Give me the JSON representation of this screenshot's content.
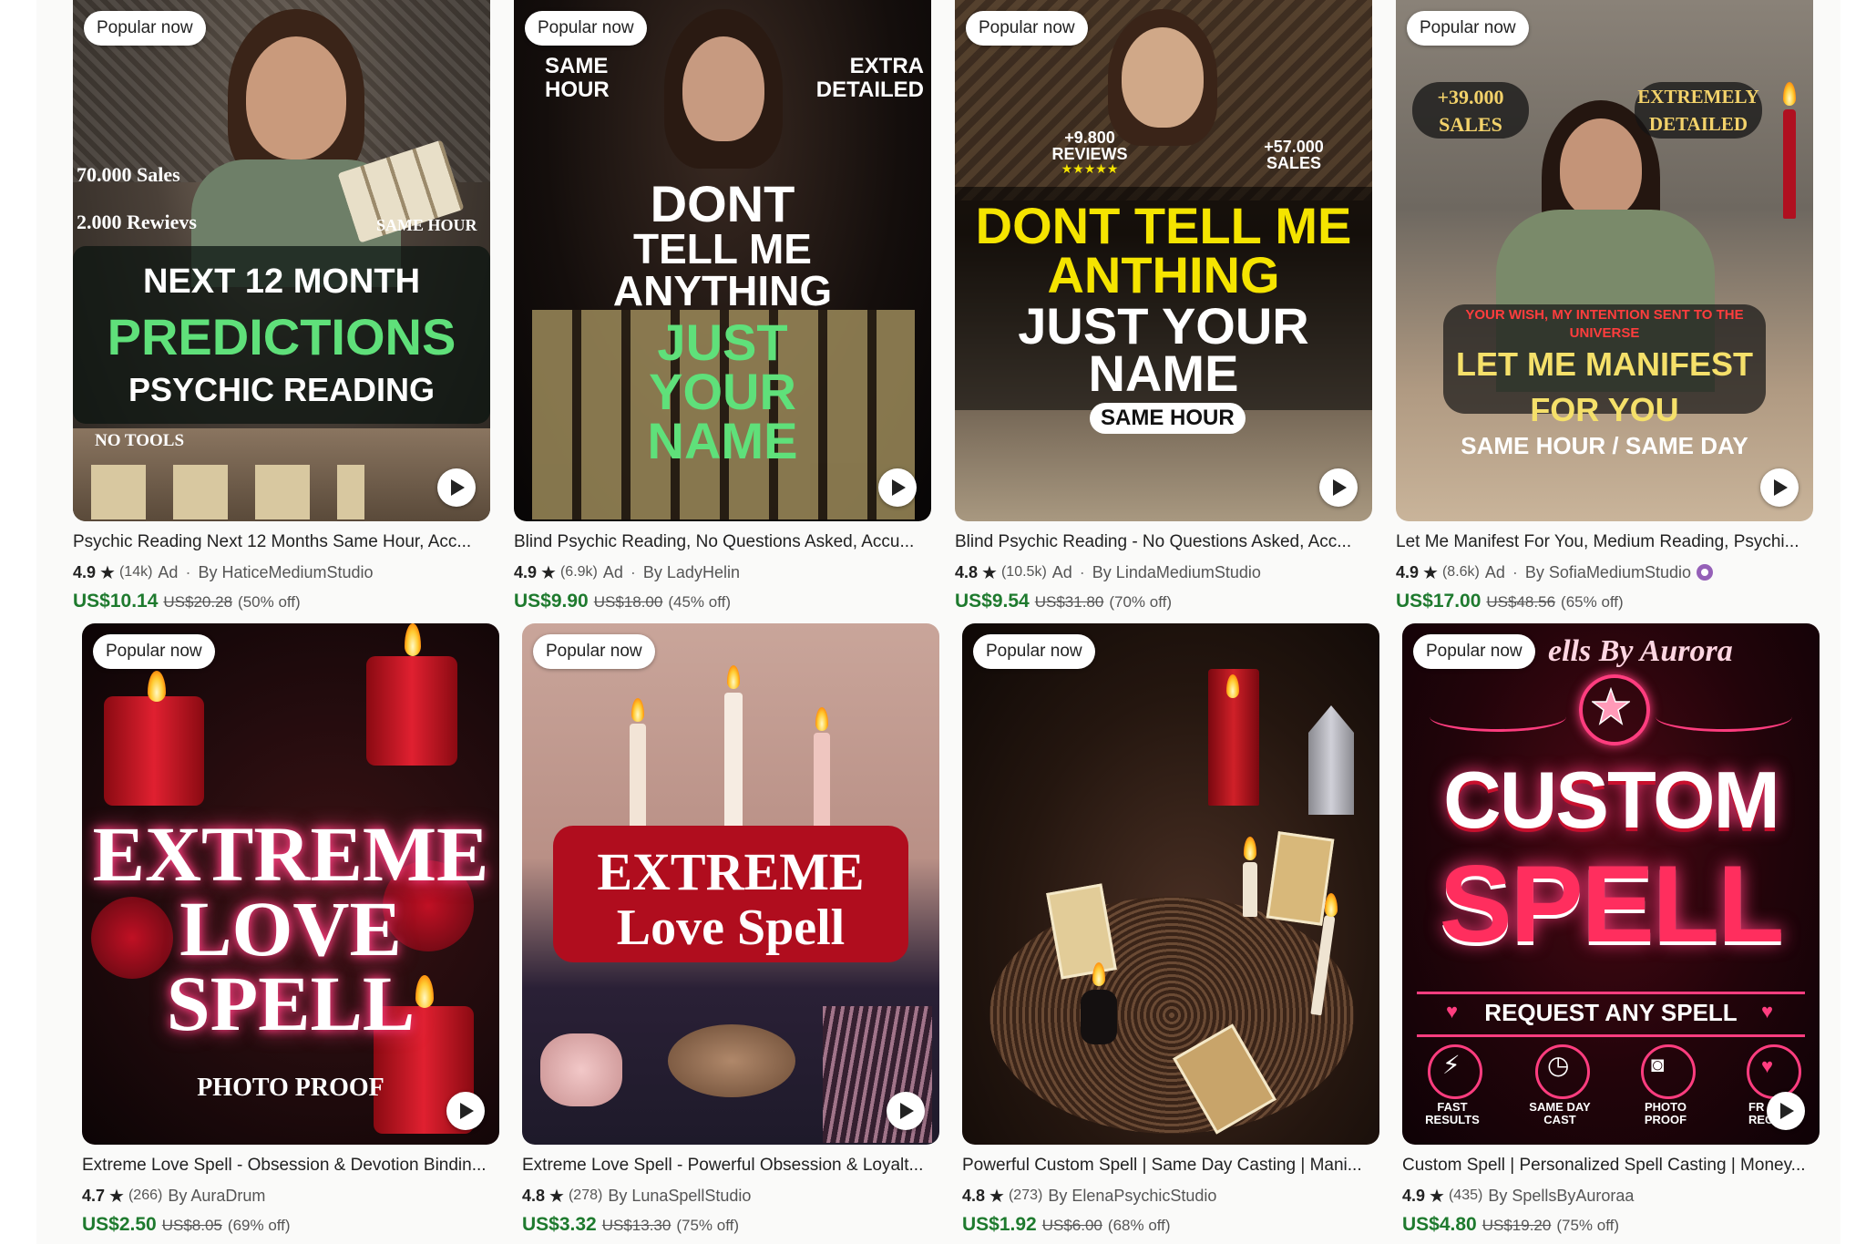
{
  "listings": [
    {
      "badge": "Popular now",
      "title": "Psychic Reading Next 12 Months Same Hour, Acc...",
      "rating": "4.9",
      "reviews": "(14k)",
      "ad": "Ad",
      "by": "By HaticeMediumStudio",
      "price": "US$10.14",
      "original_price": "US$20.28",
      "discount": "(50% off)",
      "thumb": {
        "line1": "70.000 Sales",
        "line2": "2.000 Rewievs",
        "line3": "SAME HOUR",
        "line4": "NEXT 12 MONTH",
        "line5": "PREDICTIONS",
        "line6": "PSYCHIC READING",
        "line7": "NO TOOLS"
      }
    },
    {
      "badge": "Popular now",
      "title": "Blind Psychic Reading, No Questions Asked, Accu...",
      "rating": "4.9",
      "reviews": "(6.9k)",
      "ad": "Ad",
      "by": "By LadyHelin",
      "price": "US$9.90",
      "original_price": "US$18.00",
      "discount": "(45% off)",
      "thumb": {
        "line1": "SAME HOUR",
        "line2": "EXTRA DETAILED",
        "line3": "DONT",
        "line4": "TELL ME",
        "line5": "ANYTHING",
        "line6": "JUST",
        "line7": "YOUR",
        "line8": "NAME"
      }
    },
    {
      "badge": "Popular now",
      "title": "Blind Psychic Reading - No Questions Asked, Acc...",
      "rating": "4.8",
      "reviews": "(10.5k)",
      "ad": "Ad",
      "by": "By LindaMediumStudio",
      "price": "US$9.54",
      "original_price": "US$31.80",
      "discount": "(70% off)",
      "thumb": {
        "line1": "+9.800",
        "line2": "REVIEWS",
        "line3": "+57.000",
        "line4": "SALES",
        "line5": "DONT TELL ME",
        "line6": "ANTHING",
        "line7": "JUST YOUR",
        "line8": "NAME",
        "line9": "SAME HOUR",
        "stars": "★★★★★"
      }
    },
    {
      "badge": "Popular now",
      "title": "Let Me Manifest For You, Medium Reading, Psychi...",
      "rating": "4.9",
      "reviews": "(8.6k)",
      "ad": "Ad",
      "by": "By SofiaMediumStudio",
      "price": "US$17.00",
      "original_price": "US$48.56",
      "discount": "(65% off)",
      "thumb": {
        "line1": "+39.000",
        "line2": "SALES",
        "line3": "EXTREMELY",
        "line4": "DETAILED",
        "line5": "YOUR WISH, MY INTENTION SENT TO THE",
        "line6": "UNIVERSE",
        "line7": "LET ME MANIFEST",
        "line8": "FOR YOU",
        "line9": "SAME HOUR / SAME DAY"
      }
    },
    {
      "badge": "Popular now",
      "title": "Extreme Love Spell - Obsession & Devotion Bindin...",
      "rating": "4.7",
      "reviews": "(266)",
      "by": "By AuraDrum",
      "price": "US$2.50",
      "original_price": "US$8.05",
      "discount": "(69% off)",
      "thumb": {
        "line1": "EXTREME",
        "line2": "LOVE",
        "line3": "SPELL",
        "line4": "PHOTO PROOF"
      }
    },
    {
      "badge": "Popular now",
      "title": "Extreme Love Spell - Powerful Obsession & Loyalt...",
      "rating": "4.8",
      "reviews": "(278)",
      "by": "By LunaSpellStudio",
      "price": "US$3.32",
      "original_price": "US$13.30",
      "discount": "(75% off)",
      "thumb": {
        "line1": "EXTREME",
        "line2": "Love Spell"
      }
    },
    {
      "badge": "Popular now",
      "title": "Powerful Custom Spell | Same Day Casting | Mani...",
      "rating": "4.8",
      "reviews": "(273)",
      "by": "By ElenaPsychicStudio",
      "price": "US$1.92",
      "original_price": "US$6.00",
      "discount": "(68% off)",
      "thumb": {}
    },
    {
      "badge": "Popular now",
      "title": "Custom Spell | Personalized Spell Casting | Money...",
      "rating": "4.9",
      "reviews": "(435)",
      "by": "By SpellsByAuroraa",
      "price": "US$4.80",
      "original_price": "US$19.20",
      "discount": "(75% off)",
      "thumb": {
        "line1": "ells By Aurora",
        "line2": "CUSTOM",
        "line3": "SPELL",
        "line4": "REQUEST ANY SPELL",
        "feature1": "FAST RESULTS",
        "feature2": "SAME DAY CAST",
        "feature3": "PHOTO PROOF",
        "feature4": "FR REC"
      }
    }
  ],
  "colors": {
    "price_green": "#1e7a2e",
    "neon_green": "#5fe07a",
    "yellow": "#f5e400",
    "crimson": "#c8102e",
    "pink": "#ff3d7f"
  },
  "icons": [
    "star-icon",
    "play-icon",
    "verified-icon",
    "lightning-icon",
    "clock-icon",
    "camera-icon",
    "heart-icon"
  ]
}
